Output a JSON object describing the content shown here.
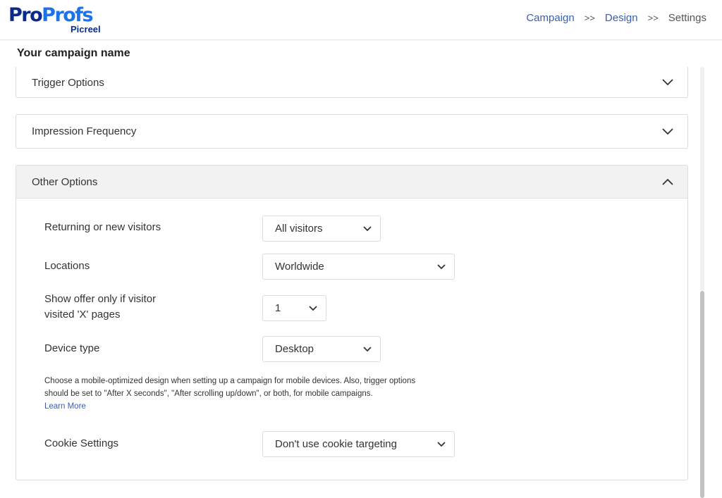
{
  "logo": {
    "pro": "Pro",
    "profs": "Profs",
    "sub": "Picreel"
  },
  "breadcrumb": {
    "step1": "Campaign",
    "sep1": ">>",
    "step2": "Design",
    "sep2": ">>",
    "step3": "Settings"
  },
  "campaign_name": "Your campaign name",
  "panels": {
    "trigger": {
      "title": "Trigger Options",
      "icon": "chevron-down-icon"
    },
    "impression": {
      "title": "Impression Frequency",
      "icon": "chevron-down-icon"
    },
    "other": {
      "title": "Other Options",
      "icon": "chevron-up-icon",
      "visitors": {
        "label": "Returning or new visitors",
        "value": "All visitors"
      },
      "locations": {
        "label": "Locations",
        "value": "Worldwide"
      },
      "pages": {
        "label_line1": "Show offer only if visitor",
        "label_line2": "visited 'X' pages",
        "value": "1"
      },
      "device": {
        "label": "Device type",
        "value": "Desktop"
      },
      "help_text": "Choose a mobile-optimized design when setting up a campaign for mobile devices. Also, trigger options should be set to \"After X seconds\", \"After scrolling up/down\", or both, for mobile campaigns.",
      "learn_more": "Learn More",
      "cookie": {
        "label": "Cookie Settings",
        "value": "Don't use cookie targeting"
      }
    }
  },
  "colors": {
    "brand_dark": "#0a2a8c",
    "brand_light": "#1e73e8",
    "link": "#3b5fb0"
  }
}
